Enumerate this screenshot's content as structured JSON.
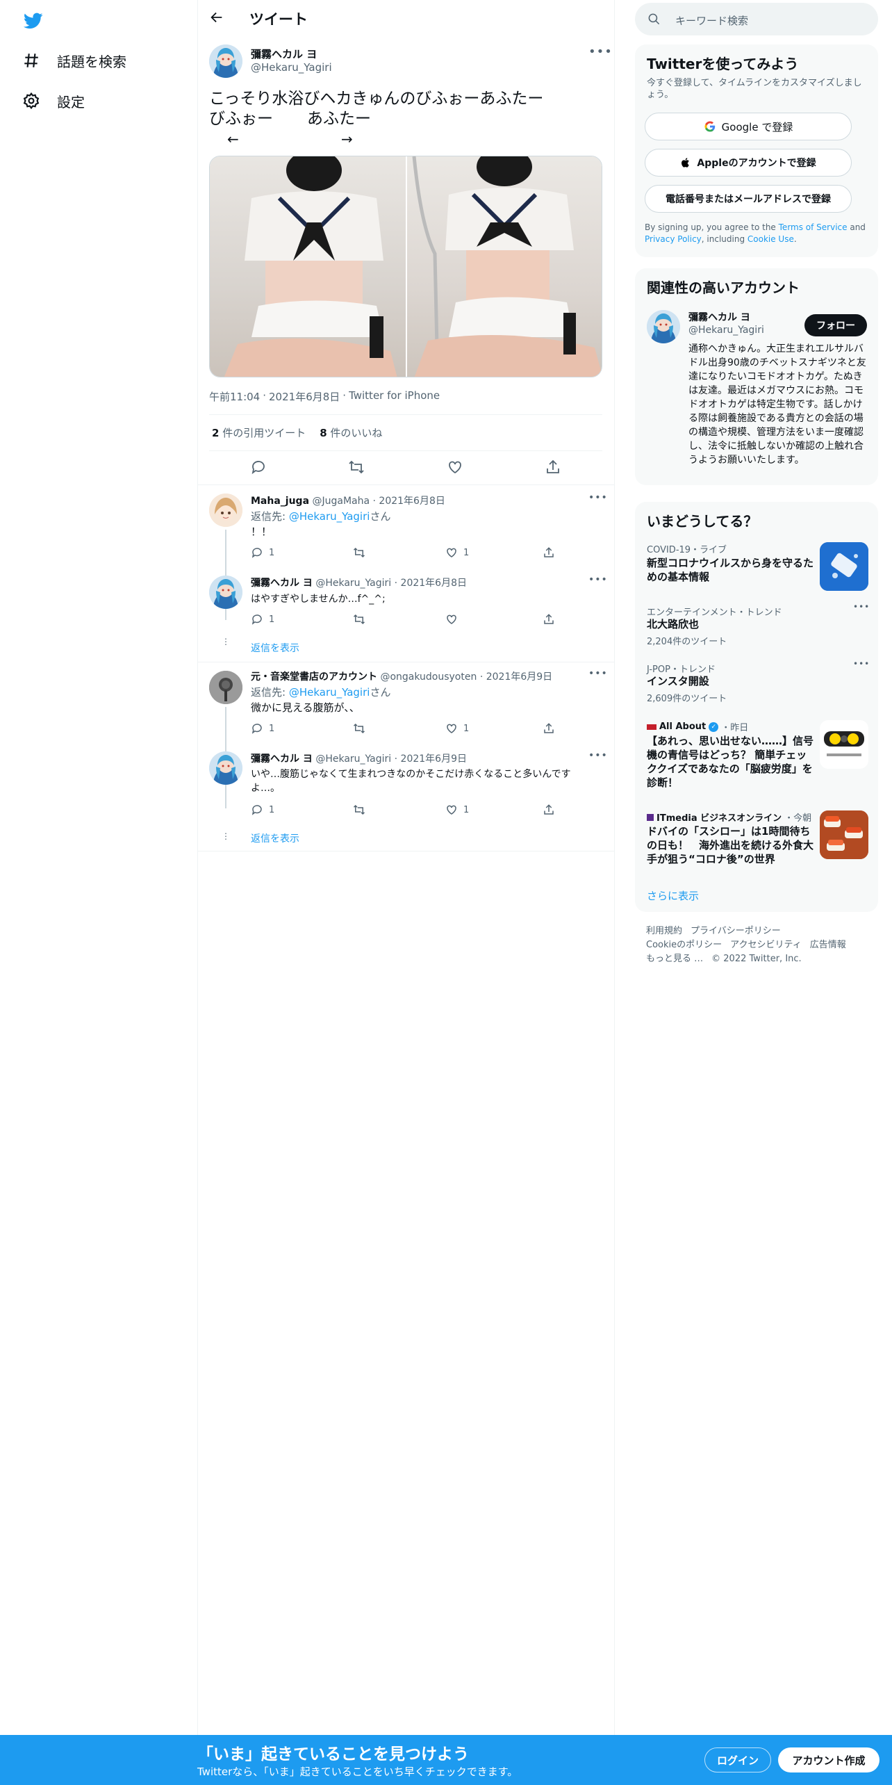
{
  "nav": {
    "items": [
      {
        "label": "話題を検索",
        "icon": "hashtag-icon"
      },
      {
        "label": "設定",
        "icon": "gear-icon"
      }
    ]
  },
  "header": {
    "title": "ツイート"
  },
  "tweet": {
    "author_name": "彌霧ヘカル ヨ",
    "author_handle": "@Hekaru_Yagiri",
    "text_line1": "こっそり水浴びヘカきゅんのびふぉーあふたー",
    "text_before": "びふぉー",
    "text_after": "あふたー",
    "arrow_left": "←",
    "arrow_right": "→",
    "meta_time": "午前11:04",
    "meta_date": "2021年6月8日",
    "meta_source": "Twitter for iPhone",
    "quote_count": "2",
    "quote_label": " 件の引用ツイート",
    "like_count": "8",
    "like_label": " 件のいいね"
  },
  "replies": [
    {
      "name": "Maha_juga",
      "handle": "@JugaMaha",
      "date": "2021年6月8日",
      "reply_prefix": "返信先: ",
      "reply_to": "@Hekaru_Yagiri",
      "reply_suffix": "さん",
      "text": "！！",
      "reply_count": "1",
      "like_count": "1"
    },
    {
      "name": "彌霧ヘカル ヨ",
      "handle": "@Hekaru_Yagiri",
      "date": "2021年6月8日",
      "text": "はやすぎやしませんか…f^_^;",
      "show_replies": "返信を表示"
    },
    {
      "name": "元・音楽堂書店のアカウント",
      "handle": "@ongakudousyoten",
      "date": "2021年6月9日",
      "reply_prefix": "返信先: ",
      "reply_to": "@Hekaru_Yagiri",
      "reply_suffix": "さん",
      "text": "微かに見える腹筋が、、",
      "reply_count": "1",
      "like_count": "1"
    },
    {
      "name": "彌霧ヘカル ヨ",
      "handle": "@Hekaru_Yagiri",
      "date": "2021年6月9日",
      "text": "いや…腹筋じゃなくて生まれつきなのかそこだけ赤くなること多いんですよ…。",
      "reply_count": "1",
      "like_count": "1",
      "show_replies": "返信を表示"
    }
  ],
  "search": {
    "placeholder": "キーワード検索"
  },
  "signup": {
    "title": "Twitterを使ってみよう",
    "subtitle": "今すぐ登録して、タイムラインをカスタマイズしましょう。",
    "google_btn": "Google で登録",
    "apple_btn": "Appleのアカウントで登録",
    "phone_btn": "電話番号またはメールアドレスで登録",
    "terms_1": "By signing up, you agree to the ",
    "terms_tos": "Terms of Service",
    "terms_2": " and ",
    "terms_privacy": "Privacy Policy",
    "terms_3": ", including ",
    "terms_cookie": "Cookie Use",
    "terms_4": "."
  },
  "related": {
    "title": "関連性の高いアカウント",
    "name": "彌霧ヘカル ヨ",
    "handle": "@Hekaru_Yagiri",
    "follow": "フォロー",
    "bio": "通称ヘかきゅん。大正生まれエルサルバドル出身90歳のチベットスナギツネと友達になりたいコモドオオトカゲ。たぬきは友達。最近はメガマウスにお熱。コモドオオトカゲは特定生物です。話しかける際は飼養施設である貴方との会話の場の構造や規模、管理方法をいま一度確認し、法令に抵触しないか確認の上触れ合うようお願いいたします。"
  },
  "trends": {
    "title": "いまどうしてる？",
    "items": [
      {
        "category": "COVID-19・ライブ",
        "title": "新型コロナウイルスから身を守るための基本情報"
      },
      {
        "category": "エンターテインメント・トレンド",
        "title": "北大路欣也",
        "count": "2,204件のツイート"
      },
      {
        "category": "J-POP・トレンド",
        "title": "インスタ開設",
        "count": "2,609件のツイート"
      },
      {
        "source": "All About",
        "time": "・昨日",
        "title": "【あれっ、思い出せない……】信号機の青信号はどっち？ 簡単チェッククイズであなたの「脳疲労度」を診断！"
      },
      {
        "source": "ITmedia ビジネスオンライン",
        "time": "・今朝",
        "title": "ドバイの「スシロー」は1時間待ちの日も！　海外進出を続ける外食大手が狙う“コロナ後”の世界"
      }
    ],
    "show_more": "さらに表示"
  },
  "footer": {
    "links1": [
      "利用規約",
      "プライバシーポリシー"
    ],
    "links2": [
      "Cookieのポリシー",
      "アクセシビリティ",
      "広告情報"
    ],
    "more": "もっと見る …",
    "copyright": "© 2022 Twitter, Inc."
  },
  "banner": {
    "title": "「いま」起きていることを見つけよう",
    "subtitle": "Twitterなら、「いま」起きていることをいち早くチェックできます。",
    "login": "ログイン",
    "signup": "アカウント作成"
  },
  "colors": {
    "accent": "#1d9bf0",
    "banner": "#1d9bf0",
    "text": "#0f1419",
    "muted": "#536471"
  }
}
